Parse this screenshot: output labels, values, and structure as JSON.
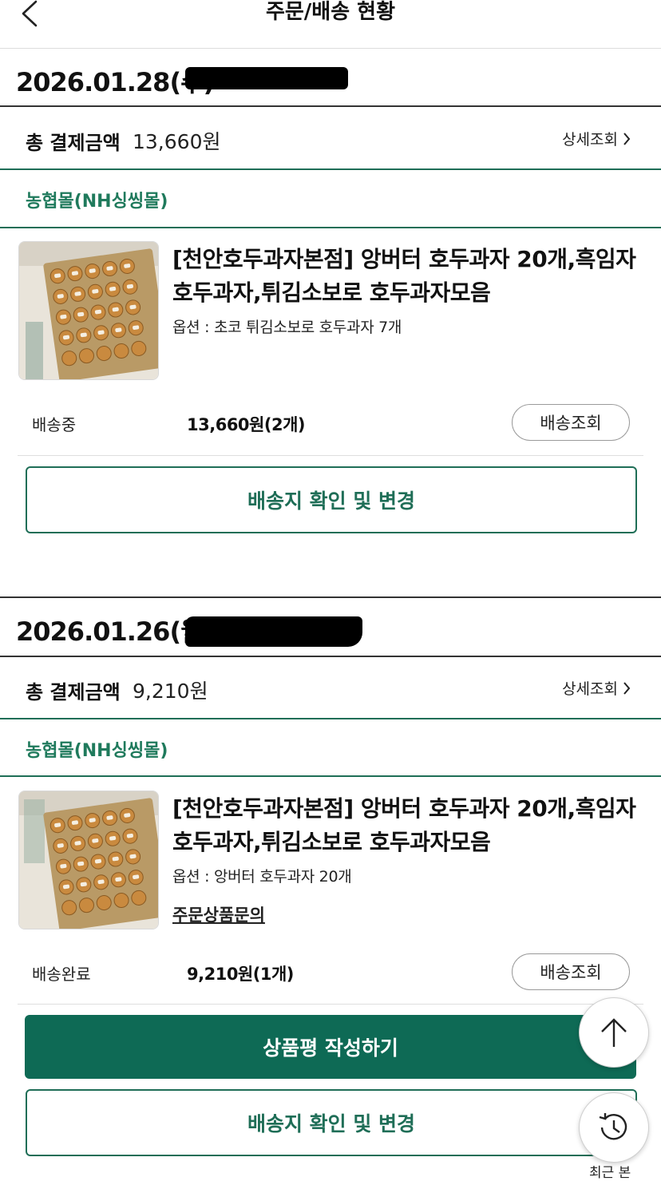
{
  "header": {
    "title": "주문/배송 현황"
  },
  "orders": [
    {
      "date": "2026.01.28(수)",
      "total_label": "총 결제금액",
      "total_value": "13,660원",
      "detail_label": "상세조회",
      "seller": "농협몰(NH싱씽몰)",
      "product_name": "[천안호두과자본점] 앙버터 호두과자 20개,흑임자 호두과자,튀김소보로 호두과자모음",
      "option": "옵션 : 초코 튀김소보로 호두과자 7개",
      "status": "배송중",
      "price": "13,660원(2개)",
      "track_label": "배송조회",
      "address_button": "배송지 확인 및 변경"
    },
    {
      "date": "2026.01.26(월)",
      "total_label": "총 결제금액",
      "total_value": "9,210원",
      "detail_label": "상세조회",
      "seller": "농협몰(NH싱씽몰)",
      "product_name": "[천안호두과자본점] 앙버터 호두과자 20개,흑임자 호두과자,튀김소보로 호두과자모음",
      "option": "옵션 : 앙버터 호두과자 20개",
      "inquiry": "주문상품문의",
      "status": "배송완료",
      "price": "9,210원(1개)",
      "track_label": "배송조회",
      "review_button": "상품평 작성하기",
      "address_button": "배송지 확인 및 변경"
    }
  ],
  "floating": {
    "history_label": "최근 본"
  },
  "colors": {
    "accent": "#0e6a55",
    "seller_text": "#1f7a5c"
  }
}
